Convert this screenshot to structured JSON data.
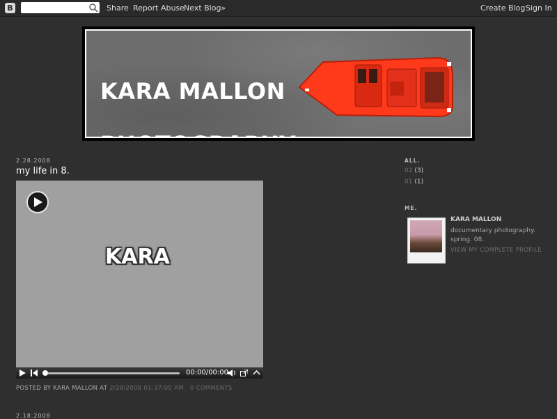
{
  "navbar": {
    "logo_letter": "B",
    "search_placeholder": "",
    "share": "Share",
    "report_abuse": "Report Abuse",
    "next_blog": "Next Blog»",
    "create_blog": "Create Blog",
    "sign_in": "Sign In"
  },
  "header": {
    "title_line1": "KARA MALLON",
    "title_line2": "PHOTOGRAPHY",
    "boat_color": "#ff3a1a"
  },
  "post": {
    "date": "2.28.2008",
    "title": "my life in 8.",
    "video": {
      "overlay_text": "KARA",
      "time": "00:00/00:00",
      "progress": 0
    },
    "footer": {
      "posted_by": "POSTED BY KARA MALLON AT",
      "timestamp": "2/28/2008 01:37:00 AM",
      "comments": "0 COMMENTS"
    }
  },
  "next_post": {
    "date": "2.18.2008"
  },
  "sidebar": {
    "archive_heading": "ALL.",
    "archive": [
      {
        "label": "02",
        "count": "(3)"
      },
      {
        "label": "01",
        "count": "(1)"
      }
    ],
    "me_heading": "ME.",
    "profile": {
      "name": "KARA MALLON",
      "description": "documentary photography. spring. 08.",
      "link": "VIEW MY COMPLETE PROFILE"
    }
  }
}
